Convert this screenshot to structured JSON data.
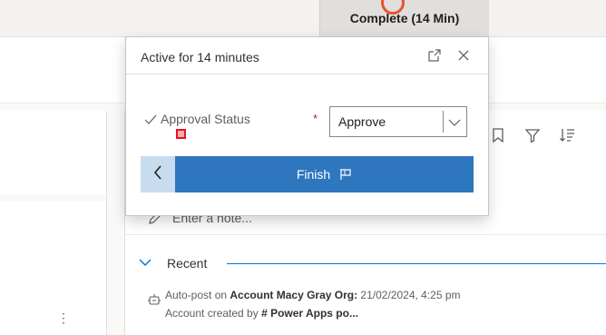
{
  "stage": {
    "complete_label": "Complete  (14 Min)"
  },
  "flyout": {
    "title": "Active for 14 minutes",
    "field_label": "Approval Status",
    "required_mark": "*",
    "select_value": "Approve",
    "finish_label": "Finish"
  },
  "timeline": {
    "note_placeholder": "Enter a note...",
    "recent_label": "Recent",
    "post": {
      "prefix": "Auto-post on ",
      "account": "Account Macy Gray Org:",
      "timestamp": " 21/02/2024, 4:25 pm",
      "line2_prefix": "Account created by ",
      "line2_bold": "# Power Apps po..."
    }
  },
  "left_card": {
    "more": "⋮"
  },
  "colors": {
    "accent": "#2e77bf",
    "back_button": "#c7dcef",
    "stage_marker": "#e8552b",
    "required": "#a4262c"
  },
  "icons": {
    "expand": "expand-icon",
    "close": "close-icon",
    "check": "check-icon",
    "chevron": "chevron-down-icon",
    "back": "chevron-left-icon",
    "flag": "flag-icon",
    "bookmark": "bookmark-icon",
    "filter": "filter-icon",
    "sort": "sort-icon",
    "pencil": "pencil-icon",
    "post": "auto-post-icon"
  }
}
